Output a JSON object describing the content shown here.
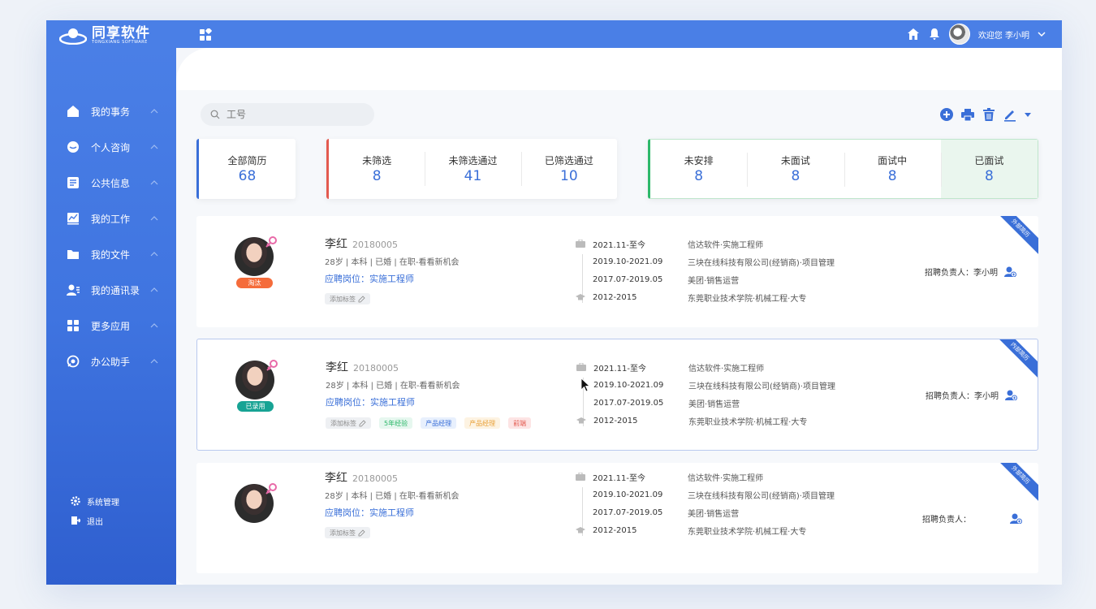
{
  "app": {
    "logo_text": "同享软件",
    "logo_sub": "TONGXIANG SOFTWARE"
  },
  "user": {
    "greeting": "欢迎您 李小明"
  },
  "sidebar": {
    "items": [
      {
        "label": "我的事务",
        "icon": "home-icon"
      },
      {
        "label": "个人咨询",
        "icon": "chat-icon"
      },
      {
        "label": "公共信息",
        "icon": "document-icon"
      },
      {
        "label": "我的工作",
        "icon": "chart-icon"
      },
      {
        "label": "我的文件",
        "icon": "folder-icon"
      },
      {
        "label": "我的通讯录",
        "icon": "contacts-icon"
      },
      {
        "label": "更多应用",
        "icon": "apps-icon"
      },
      {
        "label": "办公助手",
        "icon": "assistant-icon"
      }
    ],
    "bottom": [
      {
        "label": "系统管理",
        "icon": "gear-icon"
      },
      {
        "label": "退出",
        "icon": "logout-icon"
      }
    ]
  },
  "search": {
    "placeholder": "工号",
    "value": ""
  },
  "stats": {
    "all": {
      "label": "全部简历",
      "value": "68"
    },
    "screen": [
      {
        "label": "未筛选",
        "value": "8"
      },
      {
        "label": "未筛选通过",
        "value": "41"
      },
      {
        "label": "已筛选通过",
        "value": "10"
      }
    ],
    "interview": [
      {
        "label": "未安排",
        "value": "8"
      },
      {
        "label": "未面试",
        "value": "8"
      },
      {
        "label": "面试中",
        "value": "8"
      },
      {
        "label": "已面试",
        "value": "8"
      }
    ]
  },
  "colors": {
    "primary": "#4a7fe6",
    "accent_blue": "#3a6fd8",
    "red": "#e35a4f",
    "green": "#2db86a",
    "teal": "#17a394",
    "orange": "#f56c3b"
  },
  "cards": [
    {
      "name": "李红",
      "id": "20180005",
      "info": "28岁 | 本科 | 已婚 | 在职-看看新机会",
      "job": "应聘岗位：实施工程师",
      "status": "淘汰",
      "corner": "外部简历",
      "add_tag": "添加标签",
      "tags": [],
      "timeline": [
        "2021.11-至今",
        "2019.10-2021.09",
        "2017.07-2019.05",
        "2012-2015"
      ],
      "companies": [
        "信达软件·实施工程师",
        "三块在线科技有限公司(经销商)·项目管理",
        "美团·销售运营",
        "东莞职业技术学院·机械工程·大专"
      ],
      "recruiter": "招聘负责人：李小明"
    },
    {
      "name": "李红",
      "id": "20180005",
      "info": "28岁 | 本科 | 已婚 | 在职-看看新机会",
      "job": "应聘岗位：实施工程师",
      "status": "已录用",
      "corner": "内部简历",
      "add_tag": "添加标签",
      "tags": [
        "5年经验",
        "产品经理",
        "产品经理",
        "前端"
      ],
      "timeline": [
        "2021.11-至今",
        "2019.10-2021.09",
        "2017.07-2019.05",
        "2012-2015"
      ],
      "companies": [
        "信达软件·实施工程师",
        "三块在线科技有限公司(经销商)·项目管理",
        "美团·销售运营",
        "东莞职业技术学院·机械工程·大专"
      ],
      "recruiter": "招聘负责人：李小明"
    },
    {
      "name": "李红",
      "id": "20180005",
      "info": "28岁 | 本科 | 已婚 | 在职-看看新机会",
      "job": "应聘岗位：实施工程师",
      "status": "",
      "corner": "外部简历",
      "add_tag": "添加标签",
      "tags": [],
      "timeline": [
        "2021.11-至今",
        "2019.10-2021.09",
        "2017.07-2019.05",
        "2012-2015"
      ],
      "companies": [
        "信达软件·实施工程师",
        "三块在线科技有限公司(经销商)·项目管理",
        "美团·销售运营",
        "东莞职业技术学院·机械工程·大专"
      ],
      "recruiter": "招聘负责人："
    }
  ]
}
